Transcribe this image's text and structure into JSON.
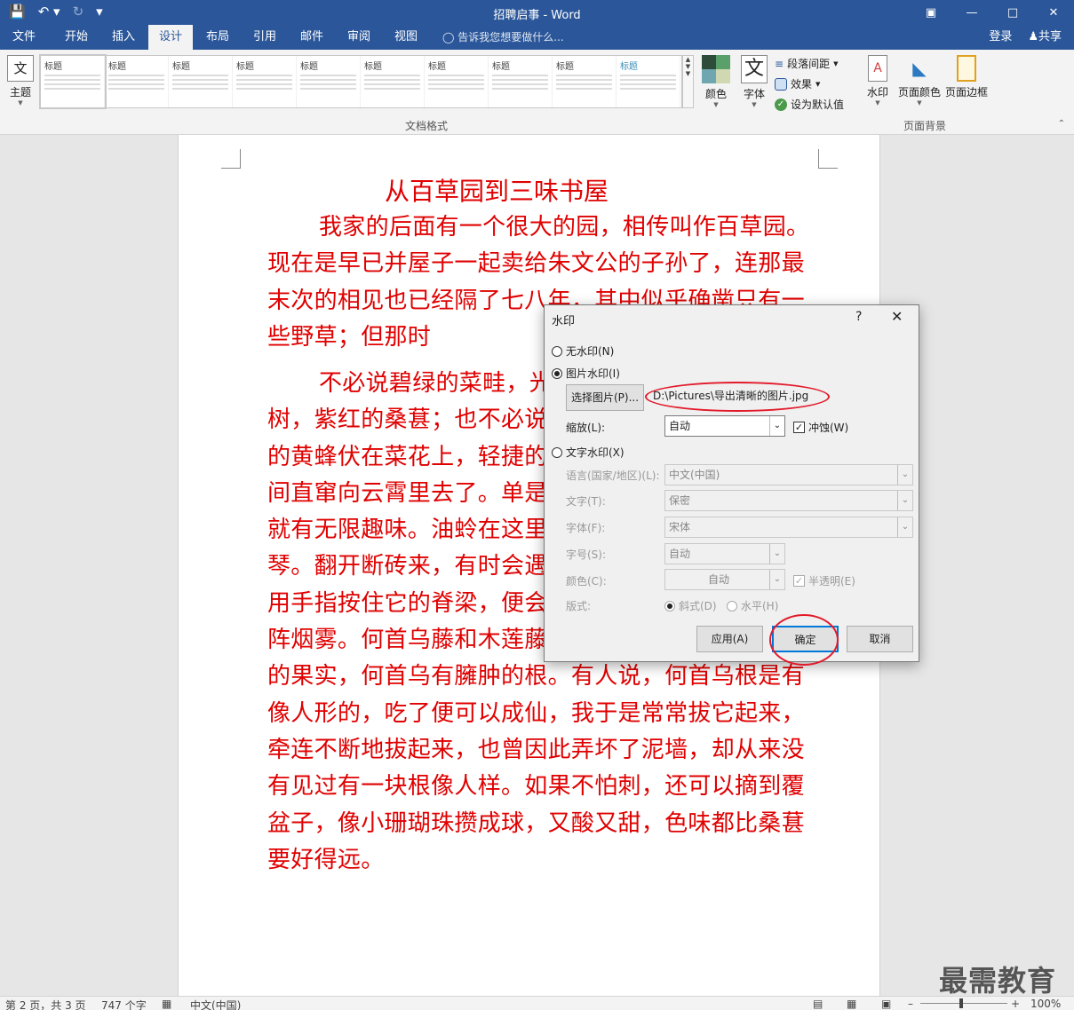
{
  "window": {
    "title": "招聘启事 - Word"
  },
  "tabs": [
    {
      "label": "文件"
    },
    {
      "label": "开始"
    },
    {
      "label": "插入"
    },
    {
      "label": "设计"
    },
    {
      "label": "布局"
    },
    {
      "label": "引用"
    },
    {
      "label": "邮件"
    },
    {
      "label": "审阅"
    },
    {
      "label": "视图"
    }
  ],
  "tellme": "告诉我您想要做什么...",
  "account": {
    "login": "登录",
    "share": "共享"
  },
  "ribbon": {
    "theme_label": "主题",
    "gallery_items": [
      "标题",
      "标题",
      "标题",
      "标题",
      "标题",
      "标题",
      "标题",
      "标题",
      "标题",
      "标题"
    ],
    "colors_label": "颜色",
    "fonts_label": "字体",
    "fonts_glyph": "文",
    "paragraph_spacing": "段落间距",
    "effects": "效果",
    "set_default": "设为默认值",
    "doc_format_group": "文档格式",
    "watermark_label": "水印",
    "page_color_label": "页面颜色",
    "page_border_label": "页面边框",
    "page_bg_group": "页面背景"
  },
  "document": {
    "title": "从百草园到三味书屋",
    "para1": "我家的后面有一个很大的园，相传叫作百草园。现在是早已并屋子一起卖给朱文公的子孙了，连那最末次的相见也已经隔了七八年，其中似乎确凿只有一些野草；但那时",
    "para2": "不必说碧绿的菜畦，光滑的石井栏，高大的皂荚树，紫红的桑葚；也不必说鸣蝉在树叶里长吟，肥胖的黄蜂伏在菜花上，轻捷的叫天子（云雀）忽然从草间直窜向云霄里去了。单是周围短短的泥墙根一带，就有无限趣味。油蛉在这里低唱，蟋蟀们在这里弹琴。翻开断砖来，有时会遇见蜈蚣；还有斑蝥，倘若用手指按住它的脊梁，便会拍的一声，从后窍喷出一阵烟雾。何首乌藤和木莲藤缠络着，木莲有莲房一般的果实，何首乌有臃肿的根。有人说，何首乌根是有像人形的，吃了便可以成仙，我于是常常拔它起来，牵连不断地拔起来，也曾因此弄坏了泥墙，却从来没有见过有一块根像人样。如果不怕刺，还可以摘到覆盆子，像小珊瑚珠攒成球，又酸又甜，色味都比桑葚要好得远。"
  },
  "dialog": {
    "title": "水印",
    "help": "?",
    "close": "✕",
    "no_watermark": "无水印(N)",
    "picture_watermark": "图片水印(I)",
    "select_picture": "选择图片(P)...",
    "picture_path": "D:\\Pictures\\导出清晰的图片.jpg",
    "scale_label": "缩放(L):",
    "scale_value": "自动",
    "washout": "冲蚀(W)",
    "text_watermark": "文字水印(X)",
    "language_label": "语言(国家/地区)(L):",
    "language_value": "中文(中国)",
    "text_label": "文字(T):",
    "text_value": "保密",
    "font_label": "字体(F):",
    "font_value": "宋体",
    "size_label": "字号(S):",
    "size_value": "自动",
    "color_label": "颜色(C):",
    "color_value": "自动",
    "semitransparent": "半透明(E)",
    "layout_label": "版式:",
    "diagonal": "斜式(D)",
    "horizontal": "水平(H)",
    "apply": "应用(A)",
    "ok": "确定",
    "cancel": "取消"
  },
  "status": {
    "page": "第 2 页，共 3 页",
    "words": "747 个字",
    "language": "中文(中国)",
    "zoom": "100%"
  },
  "watermark_text": "最需教育",
  "colors": {
    "accent": "#2b579a",
    "doc_text": "#e00000",
    "annotation": "#e21a2a"
  }
}
